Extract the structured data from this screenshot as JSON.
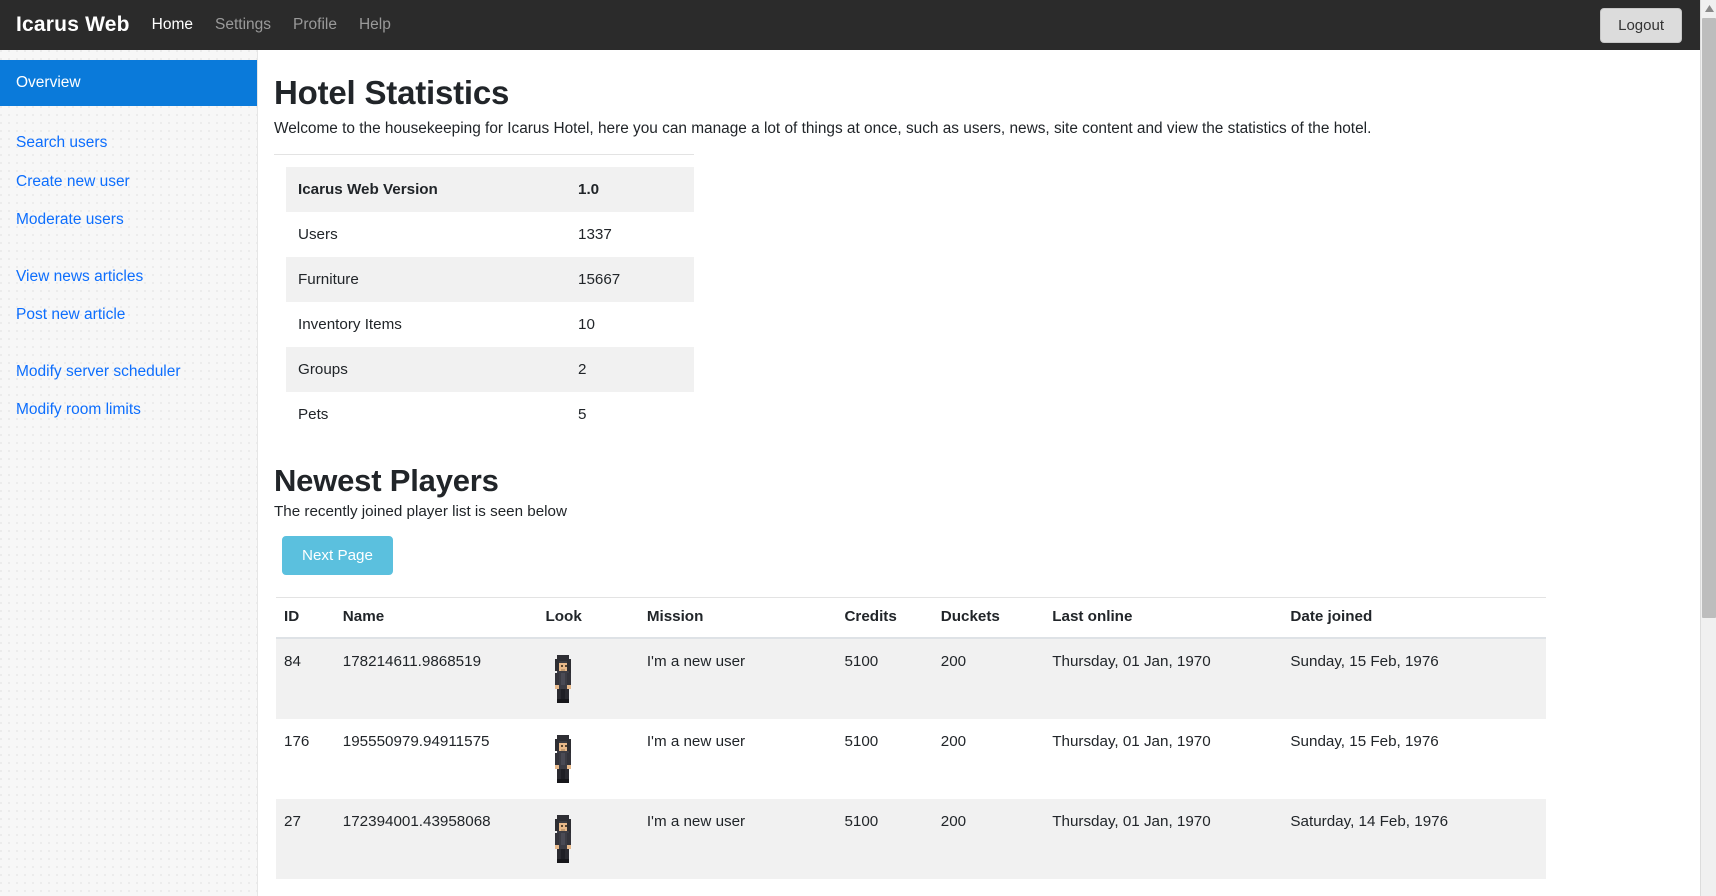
{
  "navbar": {
    "brand": "Icarus Web",
    "links": [
      {
        "label": "Home",
        "active": true
      },
      {
        "label": "Settings",
        "active": false
      },
      {
        "label": "Profile",
        "active": false
      },
      {
        "label": "Help",
        "active": false
      }
    ],
    "logout_label": "Logout"
  },
  "sidebar": {
    "items": [
      {
        "label": "Overview",
        "active": true
      },
      {
        "label": "Search users",
        "active": false
      },
      {
        "label": "Create new user",
        "active": false
      },
      {
        "label": "Moderate users",
        "active": false
      },
      {
        "label": "View news articles",
        "active": false
      },
      {
        "label": "Post new article",
        "active": false
      },
      {
        "label": "Modify server scheduler",
        "active": false
      },
      {
        "label": "Modify room limits",
        "active": false
      }
    ]
  },
  "main": {
    "page_title": "Hotel Statistics",
    "lead": "Welcome to the housekeeping for Icarus Hotel, here you can manage a lot of things at once, such as users, news, site content and view the statistics of the hotel.",
    "stats": [
      {
        "label": "Icarus Web Version",
        "value": "1.0"
      },
      {
        "label": "Users",
        "value": "1337"
      },
      {
        "label": "Furniture",
        "value": "15667"
      },
      {
        "label": "Inventory Items",
        "value": "10"
      },
      {
        "label": "Groups",
        "value": "2"
      },
      {
        "label": "Pets",
        "value": "5"
      }
    ],
    "players_section": {
      "title": "Newest Players",
      "subtext": "The recently joined player list is seen below",
      "next_page_label": "Next Page",
      "columns": [
        "ID",
        "Name",
        "Look",
        "Mission",
        "Credits",
        "Duckets",
        "Last online",
        "Date joined"
      ],
      "rows": [
        {
          "id": "84",
          "name": "178214611.9868519",
          "look": "habbo-avatar",
          "mission": "I'm a new user",
          "credits": "5100",
          "duckets": "200",
          "last_online": "Thursday, 01 Jan, 1970",
          "date_joined": "Sunday, 15 Feb, 1976"
        },
        {
          "id": "176",
          "name": "195550979.94911575",
          "look": "habbo-avatar",
          "mission": "I'm a new user",
          "credits": "5100",
          "duckets": "200",
          "last_online": "Thursday, 01 Jan, 1970",
          "date_joined": "Sunday, 15 Feb, 1976"
        },
        {
          "id": "27",
          "name": "172394001.43958068",
          "look": "habbo-avatar",
          "mission": "I'm a new user",
          "credits": "5100",
          "duckets": "200",
          "last_online": "Thursday, 01 Jan, 1970",
          "date_joined": "Saturday, 14 Feb, 1976"
        }
      ]
    }
  },
  "colors": {
    "navbar_bg": "#2b2b2b",
    "sidebar_active": "#0a7ada",
    "link_blue": "#0d6efd",
    "next_button": "#5bc0de",
    "stripe": "#f1f1f1"
  }
}
